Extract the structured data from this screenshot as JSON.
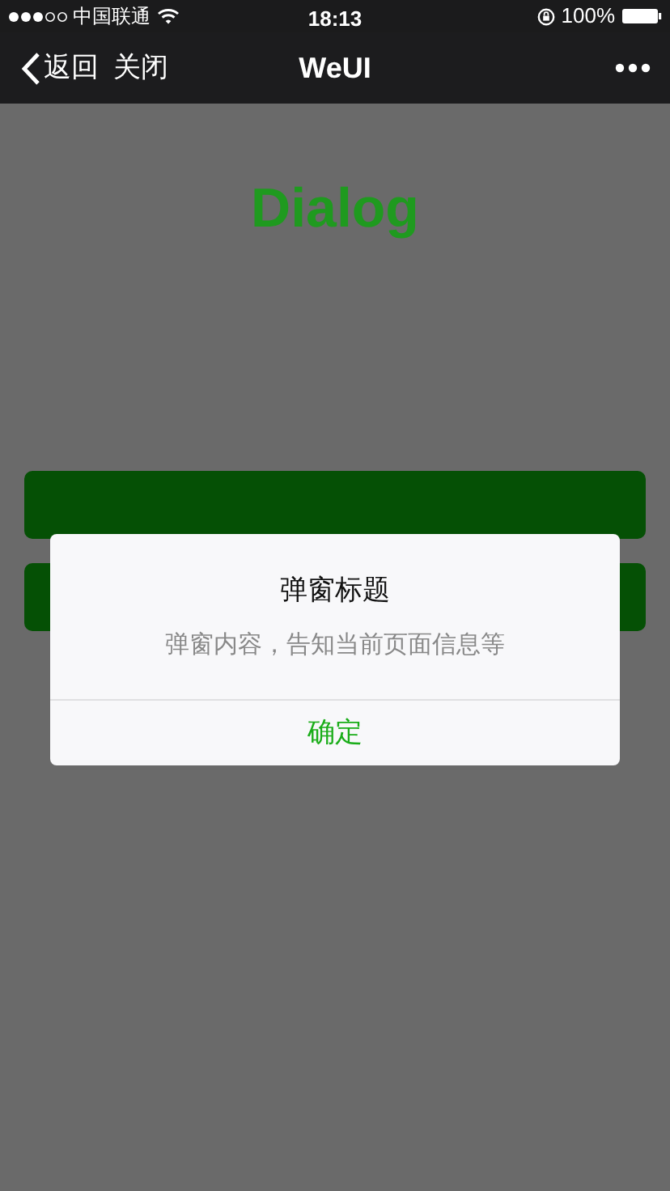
{
  "status_bar": {
    "carrier": "中国联通",
    "time": "18:13",
    "battery": "100%"
  },
  "nav_bar": {
    "back": "返回",
    "close": "关闭",
    "title": "WeUI"
  },
  "page": {
    "heading": "Dialog",
    "buttons": [
      {
        "kind": "primary"
      },
      {
        "kind": "primary"
      }
    ]
  },
  "dialog": {
    "title": "弹窗标题",
    "content": "弹窗内容，告知当前页面信息等",
    "buttons": [
      {
        "label": "确定",
        "kind": "primary"
      }
    ]
  }
}
